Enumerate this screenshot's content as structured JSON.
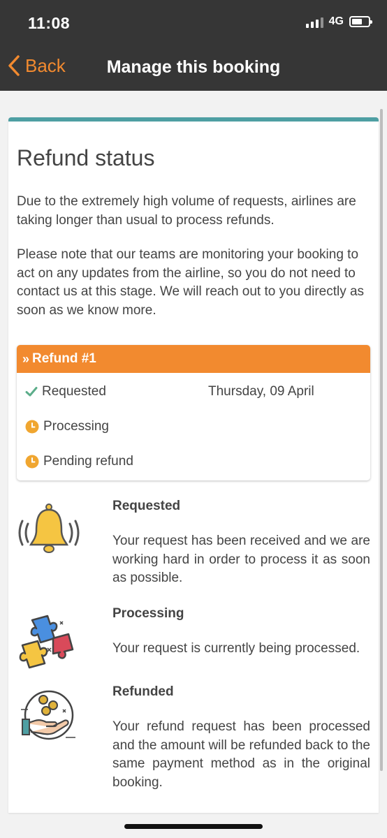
{
  "status_bar": {
    "time": "11:08",
    "network": "4G"
  },
  "nav": {
    "back_label": "Back",
    "title": "Manage this booking"
  },
  "card": {
    "title": "Refund status",
    "paragraph_1": "Due to the extremely high volume of requests, airlines are taking longer than usual to process refunds.",
    "paragraph_2": "Please note that our teams are monitoring your booking to act on any updates from the airline, so you do not need to contact us at this stage. We will reach out to you directly as soon as we know more."
  },
  "refund": {
    "header": "Refund #1",
    "steps": [
      {
        "label": "Requested",
        "date": "Thursday, 09 April",
        "icon": "check-icon",
        "color": "#5cad8a"
      },
      {
        "label": "Processing",
        "date": "",
        "icon": "clock-icon",
        "color": "#f0a630"
      },
      {
        "label": "Pending refund",
        "date": "",
        "icon": "clock-icon",
        "color": "#f0a630"
      }
    ]
  },
  "info": [
    {
      "title": "Requested",
      "text": "Your request has been received and we are working hard in order to process it as soon as possible.",
      "icon": "bell-icon"
    },
    {
      "title": "Processing",
      "text": "Your request is currently being processed.",
      "icon": "puzzle-icon"
    },
    {
      "title": "Refunded",
      "text": "Your refund request has been processed and the amount will be refunded back to the same payment method as in the original booking.",
      "icon": "coins-hand-icon"
    }
  ],
  "colors": {
    "accent": "#f28a2f",
    "teal": "#4e9fa3",
    "topbar": "#363636"
  }
}
